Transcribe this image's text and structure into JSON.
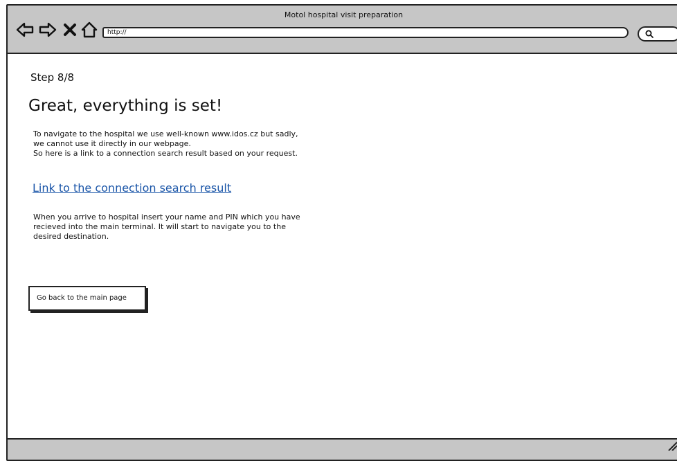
{
  "window": {
    "title": "Motol hospital visit preparation"
  },
  "toolbar": {
    "back_icon": "arrow-left-icon",
    "forward_icon": "arrow-right-icon",
    "stop_icon": "close-icon",
    "home_icon": "home-icon",
    "url_value": "http://",
    "search_icon": "search-icon"
  },
  "main": {
    "step_label": "Step 8/8",
    "heading": "Great, everything is set!",
    "intro_lines": [
      "To navigate to the hospital we use well-known www.idos.cz but sadly,",
      "we cannot use it directly in our webpage.",
      "So here is a link to a connection search result based on your request."
    ],
    "link_text": "Link to the connection search result",
    "instructions_lines": [
      "When you arrive to hospital insert your name and PIN which you have",
      "recieved into the main terminal. It will start to navigate you to the",
      "desired destination."
    ],
    "back_button_label": "Go back to the main page"
  },
  "colors": {
    "chrome": "#c6c6c6",
    "link": "#1a55a8",
    "border": "#222222"
  }
}
